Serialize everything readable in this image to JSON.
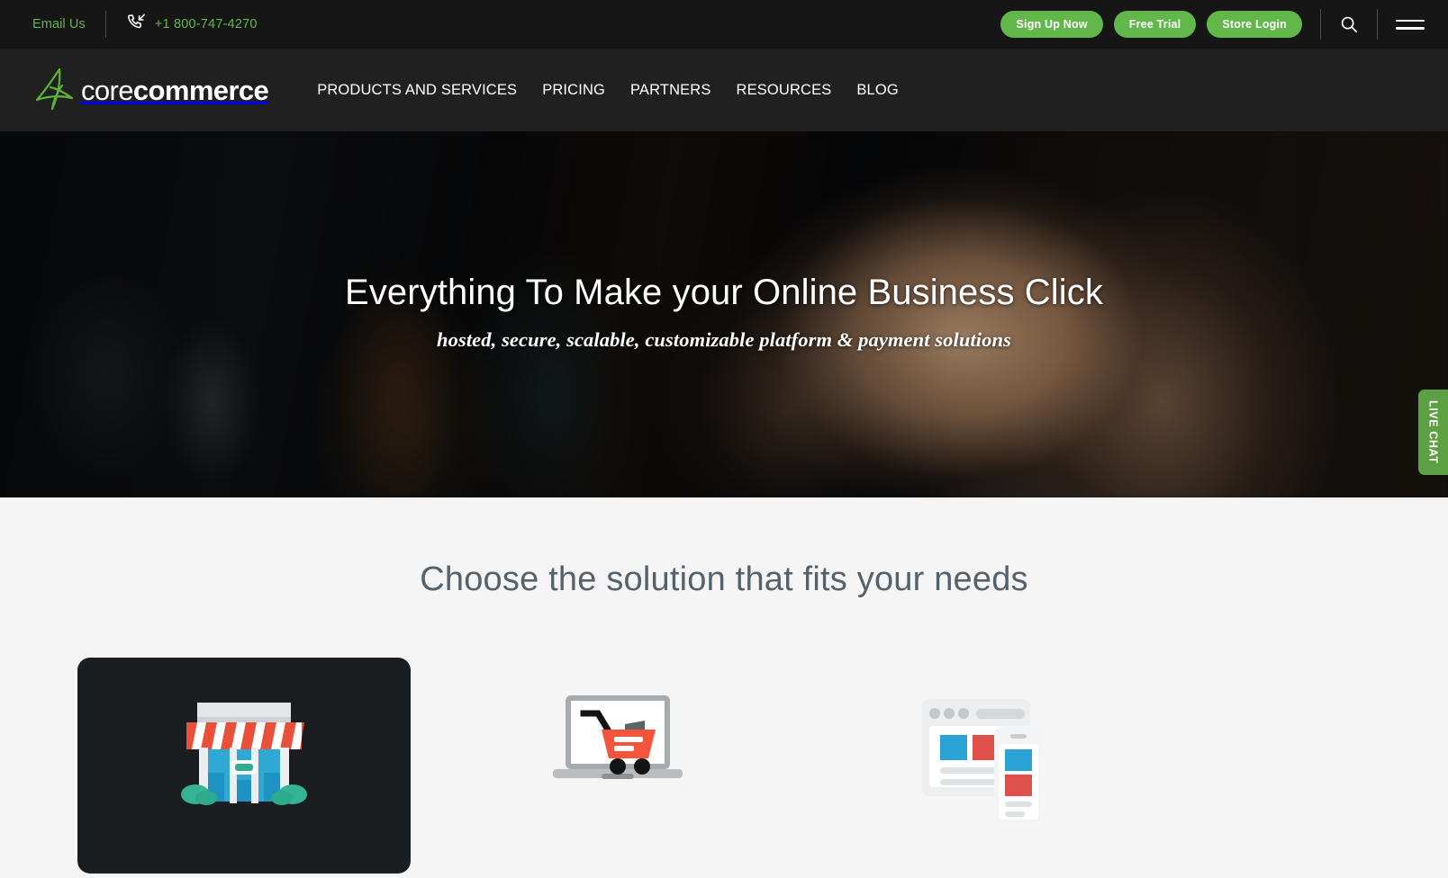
{
  "topbar": {
    "email_label": "Email Us",
    "phone_icon": "phone-incoming-icon",
    "phone_number": "+1 800-747-4270",
    "buttons": [
      {
        "label": "Sign Up Now",
        "name": "sign-up-now-button"
      },
      {
        "label": "Free Trial",
        "name": "free-trial-button"
      },
      {
        "label": "Store Login",
        "name": "store-login-button"
      }
    ],
    "search_icon": "search-icon",
    "menu_icon": "hamburger-menu-icon",
    "accent_green": "#62b74b",
    "background": "#161616"
  },
  "nav": {
    "logo": {
      "mark": "corecommerce-star-icon",
      "text_light": "core",
      "text_bold": "commerce"
    },
    "links": [
      {
        "label": "PRODUCTS AND SERVICES",
        "name": "nav-products-and-services"
      },
      {
        "label": "PRICING",
        "name": "nav-pricing"
      },
      {
        "label": "PARTNERS",
        "name": "nav-partners"
      },
      {
        "label": "RESOURCES",
        "name": "nav-resources"
      },
      {
        "label": "BLOG",
        "name": "nav-blog"
      }
    ],
    "background": "#202020"
  },
  "hero": {
    "title": "Everything To Make your Online Business Click",
    "subtitle": "hosted, secure, scalable, customizable platform & payment solutions",
    "live_chat_label": "LIVE CHAT",
    "live_chat_color": "#5ca043"
  },
  "solutions": {
    "heading": "Choose the solution that fits your needs",
    "heading_color": "#55616b",
    "background": "#f5f5f5",
    "cards": [
      {
        "name": "card-storefront",
        "icon": "storefront-icon",
        "highlighted": true,
        "card_color": "#1a1e21"
      },
      {
        "name": "card-online-store",
        "icon": "laptop-shopping-cart-icon",
        "highlighted": false
      },
      {
        "name": "card-responsive-design",
        "icon": "responsive-web-mobile-icon",
        "highlighted": false
      }
    ]
  }
}
